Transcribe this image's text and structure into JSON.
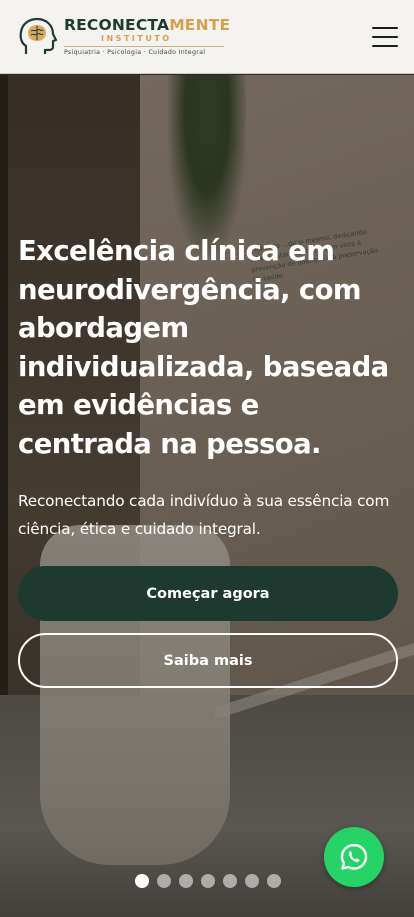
{
  "header": {
    "brand_part1": "RECONECTA",
    "brand_part2": "MENTE",
    "brand_sub": "INSTITUTO",
    "tagline": "Psiquiatria · Psicologia · Cuidado Integral",
    "menu_icon": "hamburger-menu-icon"
  },
  "hero": {
    "headline": "Excelência clínica em neurodivergência, com abordagem individualizada, baseada em evidências e centrada na pessoa.",
    "subtitle": "Reconectando cada indivíduo à sua essência com ciência, ética e cuidado integral.",
    "wall_text": "...cuidado ...de si mesmo, dedicando ...bem-estar mental, ...com vista à prevenção de doenças e à preservação da saúde.",
    "primary_button": "Começar agora",
    "secondary_button": "Saiba mais",
    "slides_total": 7,
    "active_slide": 1
  },
  "whatsapp": {
    "icon": "whatsapp-icon",
    "color": "#25d366"
  },
  "colors": {
    "brand_dark_green": "#1e3a30",
    "brand_gold": "#d4a24c",
    "header_bg": "#f4f3ef"
  }
}
